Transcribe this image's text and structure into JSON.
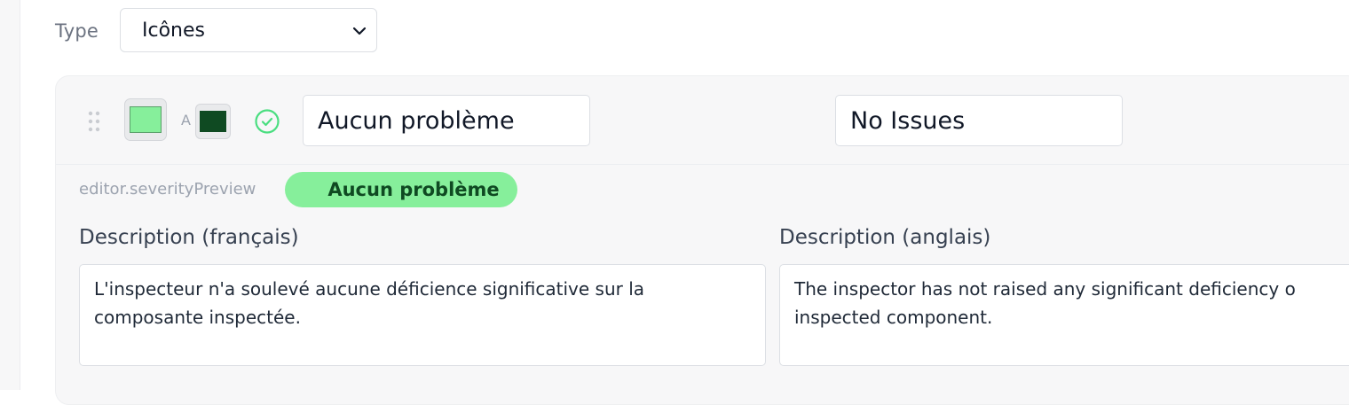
{
  "type_field": {
    "label": "Type",
    "selected": "Icônes"
  },
  "severity": {
    "background_color": "#86ef9b",
    "text_color": "#0f4a22",
    "text_color_label": "A",
    "icon": "check-circle-icon",
    "accent_color": "#4ade80",
    "name_fr": "Aucun problème",
    "name_en": "No Issues"
  },
  "preview": {
    "label": "editor.severityPreview",
    "badge_text": "Aucun problème"
  },
  "description_fr": {
    "label": "Description (français)",
    "value": "L'inspecteur n'a soulevé aucune déficience significative sur la composante inspectée."
  },
  "description_en": {
    "label": "Description (anglais)",
    "line1": "The inspector has not raised any significant deficiency o",
    "line2": "inspected component."
  }
}
